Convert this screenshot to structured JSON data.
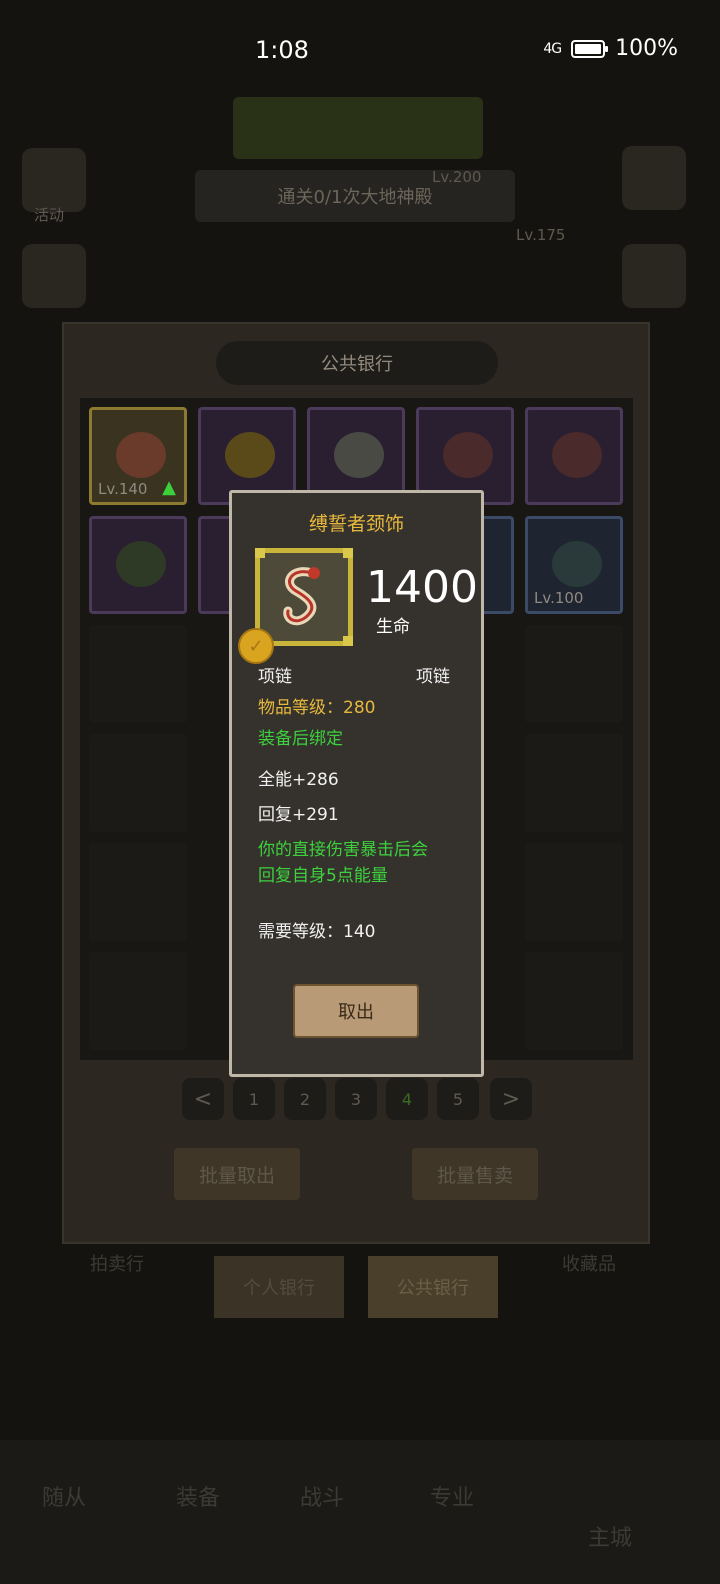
{
  "status": {
    "time": "1:08",
    "network": "4G",
    "battery": "100%"
  },
  "background": {
    "banner_text": "",
    "quest_text": "通关0/1次大地神殿",
    "left_icon_label_1": "活动",
    "left_icon_label_2": "",
    "right_text_1": "Lv.200",
    "right_text_2": "Lv.175",
    "bottom_tabs": [
      "随从",
      "装备",
      "战斗",
      "专业",
      "主城"
    ],
    "side_labels": [
      "拍卖行",
      "收藏品"
    ]
  },
  "bank": {
    "title": "公共银行",
    "slots_row1": [
      {
        "level": "Lv.140",
        "style": "gold",
        "upgrade": true
      },
      {
        "level": "",
        "style": "purple"
      },
      {
        "level": "",
        "style": "purple"
      },
      {
        "level": "",
        "style": "purple"
      },
      {
        "level": "",
        "style": "purple"
      }
    ],
    "slots_row2": [
      {
        "level": "",
        "style": "purple"
      },
      {
        "level": "",
        "style": "purple"
      },
      {
        "level": "",
        "style": "blue"
      },
      {
        "level": "",
        "style": "blue"
      },
      {
        "level": "Lv.100",
        "style": "blue"
      }
    ],
    "pager": {
      "prev": "<",
      "pages": [
        "1",
        "2",
        "3",
        "4",
        "5"
      ],
      "current": "4",
      "next": ">"
    },
    "batch_take": "批量取出",
    "batch_sell": "批量售卖",
    "tab_personal": "个人银行",
    "tab_public": "公共银行"
  },
  "tooltip": {
    "name": "缚誓者颈饰",
    "main_stat_value": "1400",
    "main_stat_label": "生命",
    "slot_type": "项链",
    "item_type": "项链",
    "item_level": "物品等级：280",
    "bind": "装备后绑定",
    "stat_1": "全能+286",
    "stat_2": "回复+291",
    "effect_line_1": "你的直接伤害暴击后会",
    "effect_line_2": "回复自身5点能量",
    "required_level": "需要等级：140",
    "take_out_button": "取出"
  }
}
